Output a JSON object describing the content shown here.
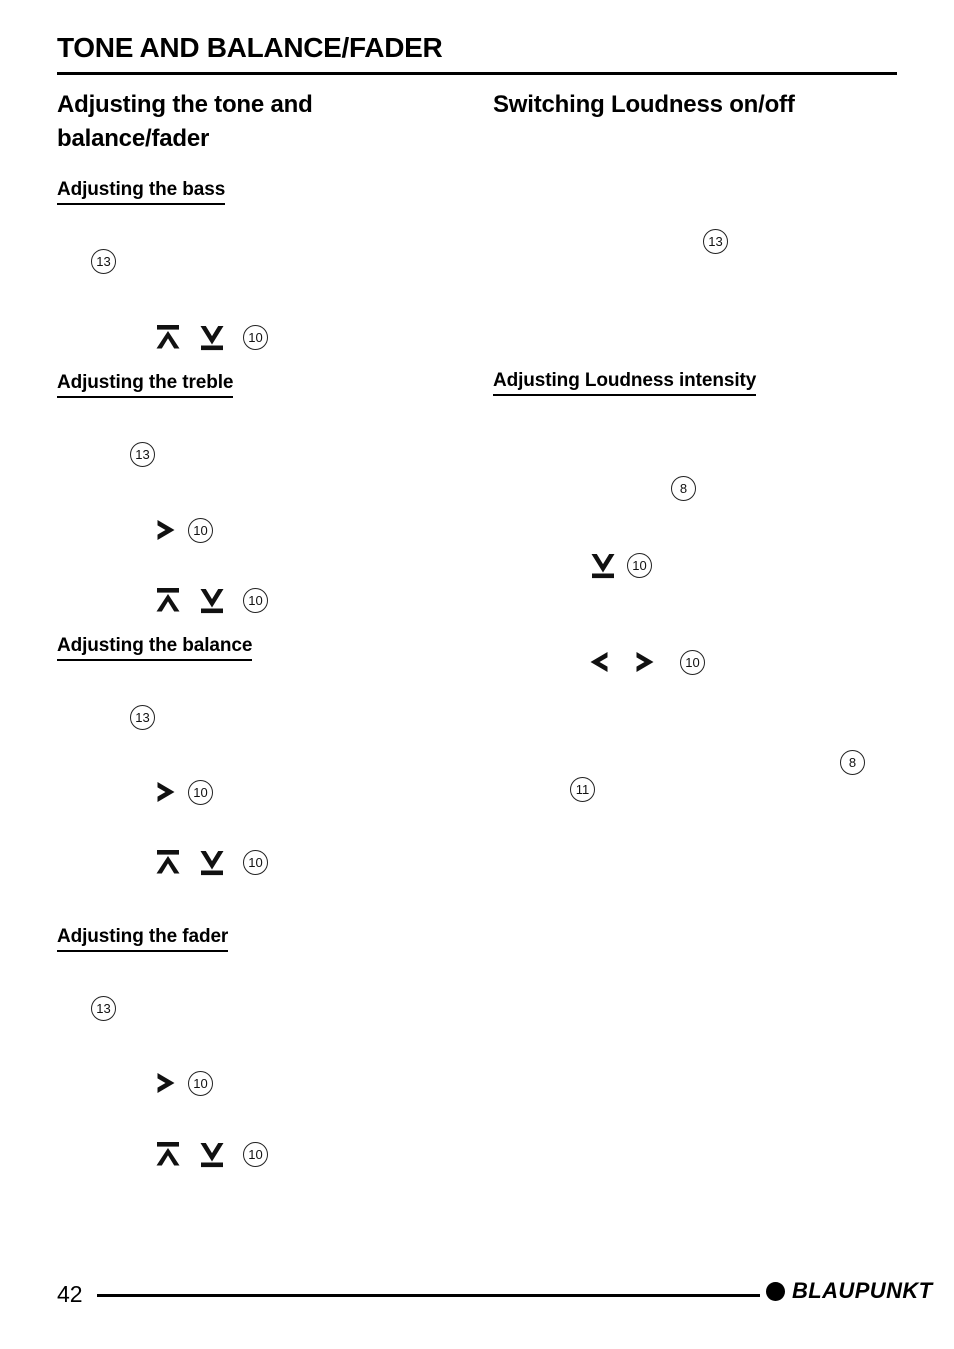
{
  "document": {
    "running_head": "TONE AND BALANCE/FADER",
    "page_number": "42"
  },
  "footer": {
    "page_number": "42",
    "brand": "BLAUPUNKT",
    "brand_dot_icon": "filled-circle-icon"
  },
  "left_column": {
    "title": "Adjusting the tone and balance/fader",
    "sections": [
      {
        "heading": "Adjusting the bass",
        "steps": [
          {
            "refs": [
              "13"
            ]
          },
          {
            "icons": [
              "chevron-up-bar-icon",
              "chevron-down-bar-icon"
            ],
            "refs": [
              "10"
            ]
          }
        ]
      },
      {
        "heading": "Adjusting the treble",
        "steps": [
          {
            "refs": [
              "13"
            ]
          },
          {
            "icons": [
              "chevron-right-icon"
            ],
            "refs": [
              "10"
            ]
          },
          {
            "icons": [
              "chevron-up-bar-icon",
              "chevron-down-bar-icon"
            ],
            "refs": [
              "10"
            ]
          }
        ]
      },
      {
        "heading": "Adjusting the balance",
        "steps": [
          {
            "refs": [
              "13"
            ]
          },
          {
            "icons": [
              "chevron-right-icon"
            ],
            "refs": [
              "10"
            ]
          },
          {
            "icons": [
              "chevron-up-bar-icon",
              "chevron-down-bar-icon"
            ],
            "refs": [
              "10"
            ]
          }
        ]
      },
      {
        "heading": "Adjusting the fader",
        "steps": [
          {
            "refs": [
              "13"
            ]
          },
          {
            "icons": [
              "chevron-right-icon"
            ],
            "refs": [
              "10"
            ]
          },
          {
            "icons": [
              "chevron-up-bar-icon",
              "chevron-down-bar-icon"
            ],
            "refs": [
              "10"
            ]
          }
        ]
      }
    ]
  },
  "right_column": {
    "title": "Switching Loudness on/off",
    "sections": [
      {
        "heading": "",
        "steps": [
          {
            "refs": [
              "13"
            ]
          }
        ]
      },
      {
        "heading": "Adjusting Loudness intensity",
        "steps": [
          {
            "refs": [
              "8"
            ]
          },
          {
            "icons": [
              "chevron-down-bar-icon"
            ],
            "refs": [
              "10"
            ]
          },
          {
            "icons": [
              "chevron-left-icon",
              "chevron-right-icon"
            ],
            "refs": [
              "10"
            ]
          },
          {
            "refs": [
              "8"
            ]
          },
          {
            "refs": [
              "11"
            ]
          }
        ]
      }
    ]
  },
  "refs": {
    "r8": "8",
    "r10": "10",
    "r11": "11",
    "r13": "13"
  },
  "colors": {
    "ink": "#000000",
    "paper": "#ffffff",
    "ref_outline": "#222222"
  }
}
